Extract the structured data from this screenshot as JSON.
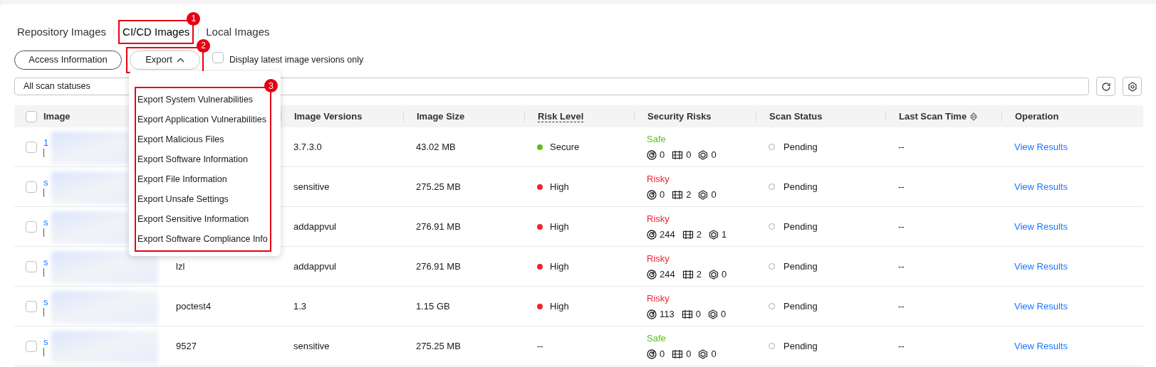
{
  "tabs": [
    {
      "label": "Repository Images",
      "selected": false
    },
    {
      "label": "CI/CD Images",
      "selected": true,
      "callout": "1"
    },
    {
      "label": "Local Images",
      "selected": false
    }
  ],
  "toolbar": {
    "access_button": "Access Information",
    "export_button": "Export",
    "export_callout": "2",
    "export_expanded": true,
    "latest_only": {
      "label": "Display latest image versions only",
      "checked": false
    }
  },
  "export_menu": {
    "callout": "3",
    "items": [
      "Export System Vulnerabilities",
      "Export Application Vulnerabilities",
      "Export Malicious Files",
      "Export Software Information",
      "Export File Information",
      "Export Unsafe Settings",
      "Export Sensitive Information",
      "Export Software Compliance Info"
    ]
  },
  "filter": {
    "value": "All scan statuses"
  },
  "table": {
    "all_selected": false,
    "columns": [
      "Image",
      null,
      "Image Versions",
      "Image Size",
      "Risk Level",
      "Security Risks",
      "Scan Status",
      "Last Scan Time",
      "Operation"
    ],
    "rows": [
      {
        "selected": false,
        "image_head": "1",
        "version": "3.7.3.0",
        "size": "43.02 MB",
        "risk": {
          "label": "Secure",
          "color": "#52c41a"
        },
        "security": {
          "status": "Safe",
          "kind": "safe",
          "counts": [
            "0",
            "0",
            "0"
          ]
        },
        "scan_status": "Pending",
        "last_scan": "--",
        "operation": "View Results"
      },
      {
        "selected": false,
        "image_head": "s",
        "version": "sensitive",
        "size": "275.25 MB",
        "risk": {
          "label": "High",
          "color": "#f5222d"
        },
        "security": {
          "status": "Risky",
          "kind": "risky",
          "counts": [
            "0",
            "2",
            "0"
          ]
        },
        "scan_status": "Pending",
        "last_scan": "--",
        "operation": "View Results"
      },
      {
        "selected": false,
        "image_head": "s",
        "version": "addappvul",
        "size": "276.91 MB",
        "risk": {
          "label": "High",
          "color": "#f5222d"
        },
        "security": {
          "status": "Risky",
          "kind": "risky",
          "counts": [
            "244",
            "2",
            "1"
          ]
        },
        "scan_status": "Pending",
        "last_scan": "--",
        "operation": "View Results"
      },
      {
        "selected": false,
        "image_head": "s",
        "column_2": "lzl",
        "version": "addappvul",
        "size": "276.91 MB",
        "risk": {
          "label": "High",
          "color": "#f5222d"
        },
        "security": {
          "status": "Risky",
          "kind": "risky",
          "counts": [
            "244",
            "2",
            "0"
          ]
        },
        "scan_status": "Pending",
        "last_scan": "--",
        "operation": "View Results"
      },
      {
        "selected": false,
        "image_head": "s",
        "column_2": "poctest4",
        "version": "1.3",
        "size": "1.15 GB",
        "risk": {
          "label": "High",
          "color": "#f5222d"
        },
        "security": {
          "status": "Risky",
          "kind": "risky",
          "counts": [
            "113",
            "0",
            "0"
          ]
        },
        "scan_status": "Pending",
        "last_scan": "--",
        "operation": "View Results"
      },
      {
        "selected": false,
        "image_head": "s",
        "column_2": "9527",
        "version": "sensitive",
        "size": "275.25 MB",
        "risk": {
          "label": "--"
        },
        "security": {
          "status": "Safe",
          "kind": "safe",
          "counts": [
            "0",
            "0",
            "0"
          ]
        },
        "scan_status": "Pending",
        "last_scan": "--",
        "operation": "View Results"
      }
    ]
  }
}
